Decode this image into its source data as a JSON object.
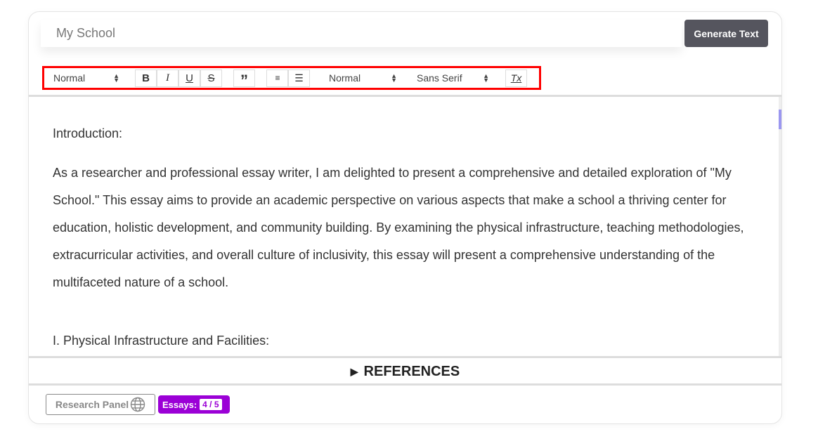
{
  "topic_input": {
    "value": "My School"
  },
  "generate_button": "Generate Text",
  "toolbar": {
    "header_select": "Normal",
    "size_select": "Normal",
    "font_select": "Sans Serif",
    "bold": "B",
    "italic": "I",
    "underline": "U",
    "strike": "S",
    "quote": "”",
    "clean": "Tx"
  },
  "content": {
    "paragraphs": [
      "Introduction:",
      "As a researcher and professional essay writer, I am delighted to present a comprehensive and detailed exploration of \"My School.\" This essay aims to provide an academic perspective on various aspects that make a school a thriving center for education, holistic development, and community building. By examining the physical infrastructure, teaching methodologies, extracurricular activities, and overall culture of inclusivity, this essay will present a comprehensive understanding of the multifaceted nature of a school.",
      "",
      "I. Physical Infrastructure and Facilities:"
    ]
  },
  "references": {
    "label": "REFERENCES",
    "icon": "triangle-right-icon"
  },
  "footer": {
    "research_panel": "Research Panel",
    "essays_label": "Essays:",
    "essays_count": "4 / 5"
  },
  "colors": {
    "accent": "#9b00d6",
    "button": "#55555e",
    "highlight_border": "#ff0000",
    "scroll_thumb": "#9b97f0"
  }
}
